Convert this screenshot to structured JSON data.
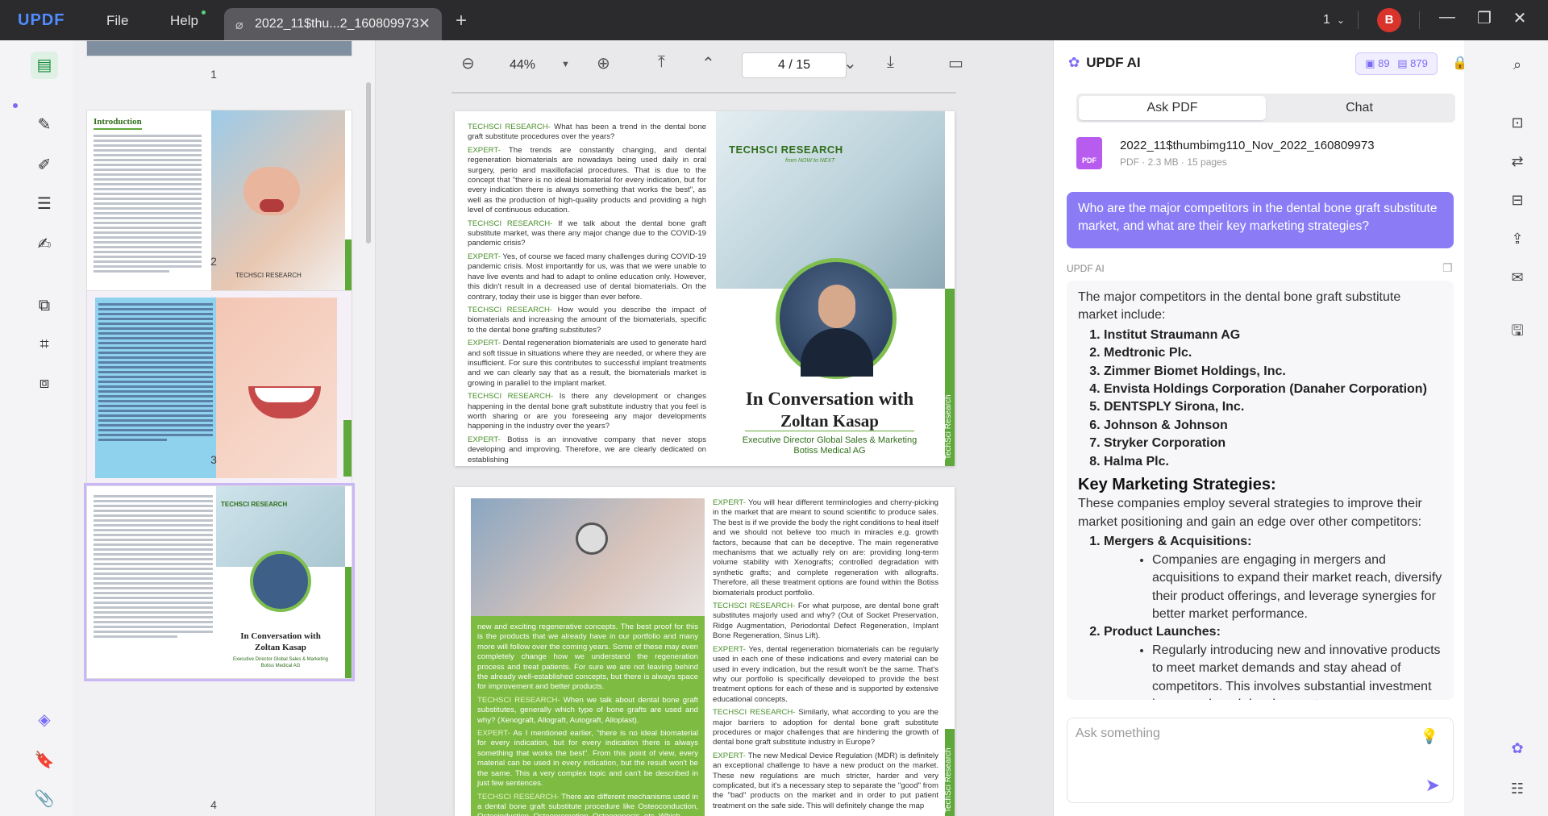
{
  "app": {
    "logo": "UPDF",
    "menus": [
      "File",
      "Help"
    ],
    "tab_title": "2022_11$thu...2_160809973",
    "window_count": "1",
    "avatar_initial": "B"
  },
  "thumbnails": {
    "labels": [
      "1",
      "2",
      "3",
      "4"
    ],
    "page2_heading": "Introduction",
    "page2_brand": "TECHSCI RESEARCH",
    "page4_brand": "TECHSCI RESEARCH",
    "page4_title": "In Conversation with",
    "page4_name": "Zoltan Kasap",
    "page4_role": "Executive Director Global Sales & Marketing",
    "page4_company": "Botiss Medical AG"
  },
  "toolbar": {
    "zoom": "44%",
    "current_page": "4",
    "total_pages": "15",
    "page_sep": "/"
  },
  "doc": {
    "page4": {
      "qa": [
        {
          "tag": "TECHSCI RESEARCH-",
          "text": " What has been a trend in the dental bone graft substitute procedures over the years?"
        },
        {
          "tag": "EXPERT-",
          "text": " The trends are constantly changing, and dental regeneration biomaterials are nowadays being used daily in oral surgery, perio and maxillofacial procedures. That is due to the concept that \"there is no ideal biomaterial for every indication, but for every indication there is always something that works the best\", as well as the production of high-quality products and providing a high level of continuous education."
        },
        {
          "tag": "TECHSCI RESEARCH-",
          "text": " If we talk about the dental bone graft substitute market, was there any major change due to the COVID-19 pandemic crisis?"
        },
        {
          "tag": "EXPERT-",
          "text": " Yes, of course we faced many challenges during COVID-19 pandemic crisis. Most importantly for us, was that we were unable to have live events and had to adapt to online education only. However, this didn't result in a decreased use of dental biomaterials. On the contrary, today their use is bigger than ever before."
        },
        {
          "tag": "TECHSCI RESEARCH-",
          "text": " How would you describe the impact of biomaterials and increasing the amount of the biomaterials, specific to the dental bone grafting substitutes?"
        },
        {
          "tag": "EXPERT-",
          "text": " Dental regeneration biomaterials are used to generate hard and soft tissue in situations where they are needed, or where they are insufficient. For sure this contributes to successful implant treatments and we can clearly say that as a result, the biomaterials market is growing in parallel to the implant market."
        },
        {
          "tag": "TECHSCI RESEARCH-",
          "text": " Is there any development or changes happening in the dental bone graft substitute industry that you feel is worth sharing or are you foreseeing any major developments happening in the industry over the years?"
        },
        {
          "tag": "EXPERT-",
          "text": " Botiss is an innovative company that never stops developing and improving. Therefore, we are clearly dedicated on establishing"
        }
      ],
      "brand": "TECHSCI RESEARCH",
      "brand_tagline": "from NOW to NEXT",
      "title": "In Conversation with",
      "name": "Zoltan Kasap",
      "role": "Executive Director Global Sales & Marketing",
      "company": "Botiss Medical AG",
      "side_text": "TechSci Research"
    },
    "page5": {
      "left_paragraphs": [
        {
          "tag": "",
          "text": "new and exciting regenerative concepts. The best proof for this is the products that we already have in our portfolio and many more will follow over the coming years. Some of these may even completely change how we understand the regeneration process and treat patients. For sure we are not leaving behind the already well-established concepts, but there is always space for improvement and better products."
        },
        {
          "tag": "TECHSCI RESEARCH-",
          "text": " When we talk about dental bone graft substitutes, generally which type of bone grafts are used and why? (Xenograft, Allograft, Autograft, Alloplast)."
        },
        {
          "tag": "EXPERT-",
          "text": " As I mentioned earlier, \"there is no ideal biomaterial for every indication, but for every indication there is always something that works the best\". From this point of view, every material can be used in every indication, but the result won't be the same. This a very complex topic and can't be described in just few sentences."
        },
        {
          "tag": "TECHSCI RESEARCH-",
          "text": " There are different mechanisms used in a dental bone graft substitute procedure like Osteoconduction, Osteoinduction, Osteopromotion, Osteogenesis, etc. Which"
        }
      ],
      "right_paragraphs": [
        {
          "tag": "EXPERT-",
          "text": " You will hear different terminologies and cherry-picking in the market that are meant to sound scientific to produce sales. The best is if we provide the body the right conditions to heal itself and we should not believe too much in miracles e.g. growth factors, because that can be deceptive. The main regenerative mechanisms that we actually rely on are: providing long-term volume stability with Xenografts; controlled degradation with synthetic grafts; and complete regeneration with allografts. Therefore, all these treatment options are found within the Botiss biomaterials product portfolio."
        },
        {
          "tag": "TECHSCI RESEARCH-",
          "text": " For what purpose, are dental bone graft substitutes majorly used and why? (Out of Socket Preservation, Ridge Augmentation, Periodontal Defect Regeneration, Implant Bone Regeneration, Sinus Lift)."
        },
        {
          "tag": "EXPERT-",
          "text": " Yes, dental regeneration biomaterials can be regularly used in each one of these indications and every material can be used in every indication, but the result won't be the same. That's why our portfolio is specifically developed to provide the best treatment options for each of these and is supported by extensive educational concepts."
        },
        {
          "tag": "TECHSCI RESEARCH-",
          "text": " Similarly, what according to you are the major barriers to adoption for dental bone graft substitute procedures or major challenges that are hindering the growth of dental bone graft substitute industry in Europe?"
        },
        {
          "tag": "EXPERT-",
          "text": " The new Medical Device Regulation (MDR) is definitely an exceptional challenge to have a new product on the market. These new regulations are much stricter, harder and very complicated, but it's a necessary step to separate the \"good\" from the \"bad\" products on the market and in order to put patient treatment on the safe side. This will definitely change the map"
        }
      ],
      "side_text": "TechSci Research"
    }
  },
  "ai": {
    "title": "UPDF AI",
    "credits_a": "89",
    "credits_b": "879",
    "tabs": [
      "Ask PDF",
      "Chat"
    ],
    "file_name": "2022_11$thumbimg110_Nov_2022_160809973",
    "file_meta": "PDF · 2.3 MB · 15 pages",
    "file_badge": "PDF",
    "question": "Who are the major competitors in the dental bone graft substitute market, and what are their key marketing strategies?",
    "role_label": "UPDF AI",
    "answer_intro": "The major competitors in the dental bone graft substitute market include:",
    "competitors": [
      "Institut Straumann AG",
      "Medtronic Plc.",
      "Zimmer Biomet Holdings, Inc.",
      "Envista Holdings Corporation (Danaher Corporation)",
      "DENTSPLY Sirona, Inc.",
      "Johnson & Johnson",
      "Stryker Corporation",
      "Halma Plc."
    ],
    "strategies_heading": "Key Marketing Strategies:",
    "strategies_intro": "These companies employ several strategies to improve their market positioning and gain an edge over other competitors:",
    "strategy1_title": "Mergers & Acquisitions:",
    "strategy1_text": "Companies are engaging in mergers and acquisitions to expand their market reach, diversify their product offerings, and leverage synergies for better market performance.",
    "strategy2_title": "Product Launches:",
    "strategy2_text": "Regularly introducing new and innovative products to meet market demands and stay ahead of competitors. This involves substantial investment in research and development.",
    "input_placeholder": "Ask something"
  },
  "colors": {
    "accent": "#7b6cf6",
    "brand_green": "#5fa83a",
    "record": "#d9342b"
  }
}
